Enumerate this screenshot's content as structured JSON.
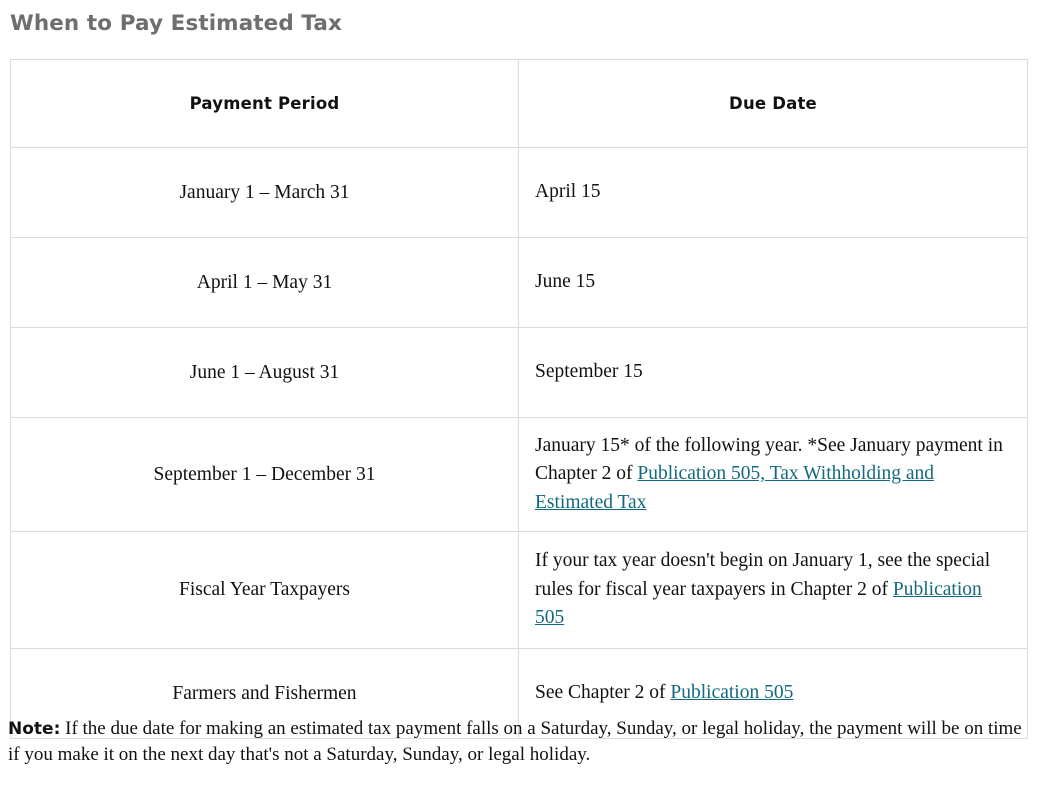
{
  "page": {
    "title": "When to Pay Estimated Tax"
  },
  "table": {
    "headers": {
      "period": "Payment Period",
      "due": "Due Date"
    },
    "rows": [
      {
        "period": "January 1 – March 31",
        "due_prefix": "April 15",
        "due_link": "",
        "due_suffix": ""
      },
      {
        "period": "April 1 – May 31",
        "due_prefix": "June 15",
        "due_link": "",
        "due_suffix": ""
      },
      {
        "period": "June 1 – August 31",
        "due_prefix": "September 15",
        "due_link": "",
        "due_suffix": ""
      },
      {
        "period": "September 1 – December 31",
        "due_prefix": "January 15* of the following year. *See January payment in Chapter 2 of ",
        "due_link": "Publication 505, Tax Withholding and Estimated Tax",
        "due_suffix": ""
      },
      {
        "period": "Fiscal Year Taxpayers",
        "due_prefix": "If your tax year doesn't begin on January 1, see the special rules for fiscal year taxpayers in Chapter 2 of ",
        "due_link": "Publication 505",
        "due_suffix": ""
      },
      {
        "period": "Farmers and Fishermen",
        "due_prefix": "See Chapter 2 of ",
        "due_link": "Publication 505",
        "due_suffix": ""
      }
    ]
  },
  "note": {
    "label": "Note:",
    "text": " If the due date for making an estimated tax payment falls on a Saturday, Sunday, or legal holiday, the payment will be on time if you make it on the next day that's not a Saturday, Sunday, or legal holiday."
  },
  "colors": {
    "title": "#6e6e6e",
    "link": "#13697f",
    "border": "#dcdcdc",
    "text": "#111111"
  }
}
